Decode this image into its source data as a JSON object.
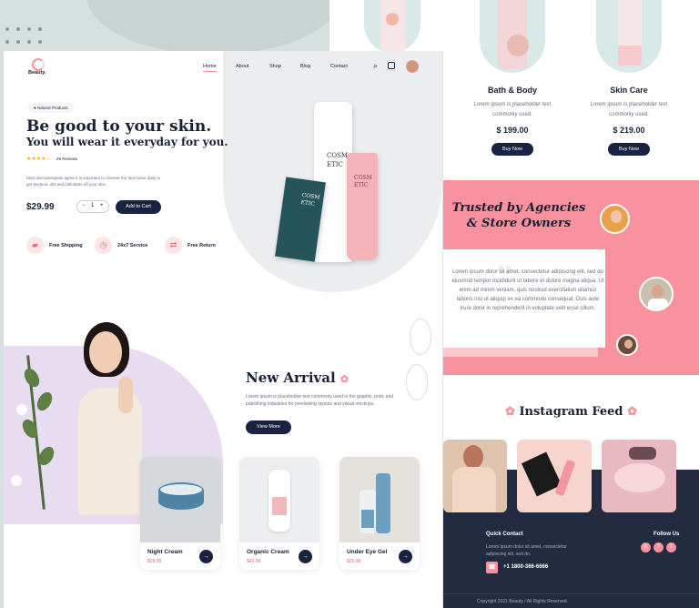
{
  "brand": {
    "name": "Beauty."
  },
  "nav": {
    "items": [
      "Home",
      "About",
      "Shop",
      "Blog",
      "Contact"
    ]
  },
  "hero": {
    "badge": "Natural Products",
    "title": "Be good to your skin.",
    "subtitle": "You will wear it everyday for you.",
    "stars": "★★★★☆",
    "reviews": "29 Reviews",
    "description": "Most dermatologists agree it is important to cleanse the face twice daily to get bacteria, dirt and pollutants off your skin.",
    "price": "$29.99",
    "qty": "1",
    "qty_minus": "−",
    "qty_plus": "+",
    "cart_label": "Add to Cart",
    "tube_text": "COSM ETIC",
    "features": [
      "Free Shipping",
      "24x7 Service",
      "Free Return"
    ]
  },
  "new_arrival": {
    "title": "New Arrival",
    "text": "Lorem ipsum is placeholder text commonly used in the graphic, print, and publishing industries for previewing layouts and visual mockups.",
    "button": "View More",
    "cards": [
      {
        "name": "Night Cream",
        "price": "$29.99"
      },
      {
        "name": "Organic Cream",
        "price": "$43.99"
      },
      {
        "name": "Under Eye Gel",
        "price": "$29.99"
      }
    ]
  },
  "top_products": [
    {
      "name": "Bath & Body",
      "text": "Lorem ipsum is placeholder text commonly used.",
      "price": "$ 199.00",
      "button": "Buy Now"
    },
    {
      "name": "Skin Care",
      "text": "Lorem ipsum is placeholder text commonly used.",
      "price": "$ 219.00",
      "button": "Buy Now"
    }
  ],
  "trust": {
    "title_line1": "Trusted by Agencies",
    "title_line2": "& Store Owners",
    "quote": "Lorem ipsum dolor sit amet, consectetur adipiscing elit, sed do eiusmod tempor incididunt ut labore et dolore magna aliqua. Ut enim ad minim veniam, quis nostrud exercitation ullamco laboris nisi ut aliquip ex ea commodo consequat. Duis aute irure dolor in reprehenderit in voluptate velit esse cillum."
  },
  "instagram": {
    "title": "Instagram Feed"
  },
  "footer": {
    "contact_title": "Quick Contact",
    "contact_text": "Lorem ipsum dolor sit amet, consectetur adipiscing elit, sed do.",
    "phone": "+1 1800-366-6666",
    "follow_title": "Follow Us",
    "copyright": "Copyright 2021 Beauty / All Rights Reserved."
  },
  "colors": {
    "navy": "#192340",
    "pink": "#f7929e",
    "lavender": "#e8dcf0",
    "mint": "#d8e9e7"
  }
}
